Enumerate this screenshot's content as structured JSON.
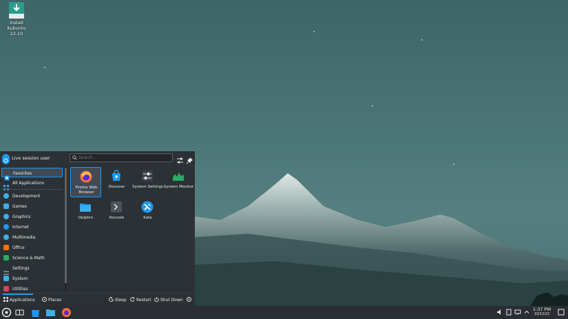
{
  "desktop": {
    "install_icon_label": "Install Kubuntu 22.10"
  },
  "menu": {
    "user_name": "Live session user",
    "search_placeholder": "Search...",
    "sidebar": [
      {
        "label": "Favorites",
        "icon": "star-icon",
        "color": "#3daee9",
        "selected": true
      },
      {
        "label": "All Applications",
        "icon": "grid-icon",
        "color": "#3daee9"
      },
      {
        "label": "Development",
        "icon": "development-icon",
        "color": "#3daee9"
      },
      {
        "label": "Games",
        "icon": "games-icon",
        "color": "#3daee9"
      },
      {
        "label": "Graphics",
        "icon": "graphics-icon",
        "color": "#3daee9"
      },
      {
        "label": "Internet",
        "icon": "globe-icon",
        "color": "#3daee9"
      },
      {
        "label": "Multimedia",
        "icon": "multimedia-icon",
        "color": "#3daee9"
      },
      {
        "label": "Office",
        "icon": "office-icon",
        "color": "#f67400"
      },
      {
        "label": "Science & Math",
        "icon": "science-icon",
        "color": "#27ae60"
      },
      {
        "label": "Settings",
        "icon": "settings-icon",
        "color": "#bdc3c7"
      },
      {
        "label": "System",
        "icon": "system-icon",
        "color": "#3daee9"
      },
      {
        "label": "Utilities",
        "icon": "utilities-icon",
        "color": "#da4453"
      }
    ],
    "apps": [
      {
        "label": "Firefox Web Browser",
        "icon": "firefox-icon",
        "selected": true
      },
      {
        "label": "Discover",
        "icon": "discover-icon"
      },
      {
        "label": "System Settings",
        "icon": "system-settings-icon"
      },
      {
        "label": "System Monitor",
        "icon": "system-monitor-icon"
      },
      {
        "label": "Dolphin",
        "icon": "dolphin-icon"
      },
      {
        "label": "Konsole",
        "icon": "konsole-icon"
      },
      {
        "label": "Kate",
        "icon": "kate-icon"
      }
    ],
    "footer": {
      "applications": "Applications",
      "places": "Places",
      "sleep": "Sleep",
      "restart": "Restart",
      "shutdown": "Shut Down"
    }
  },
  "taskbar": {
    "time": "1:37 PM",
    "date": "10/12/22"
  },
  "colors": {
    "accent": "#1d99f3",
    "panel": "#2a2e32"
  }
}
